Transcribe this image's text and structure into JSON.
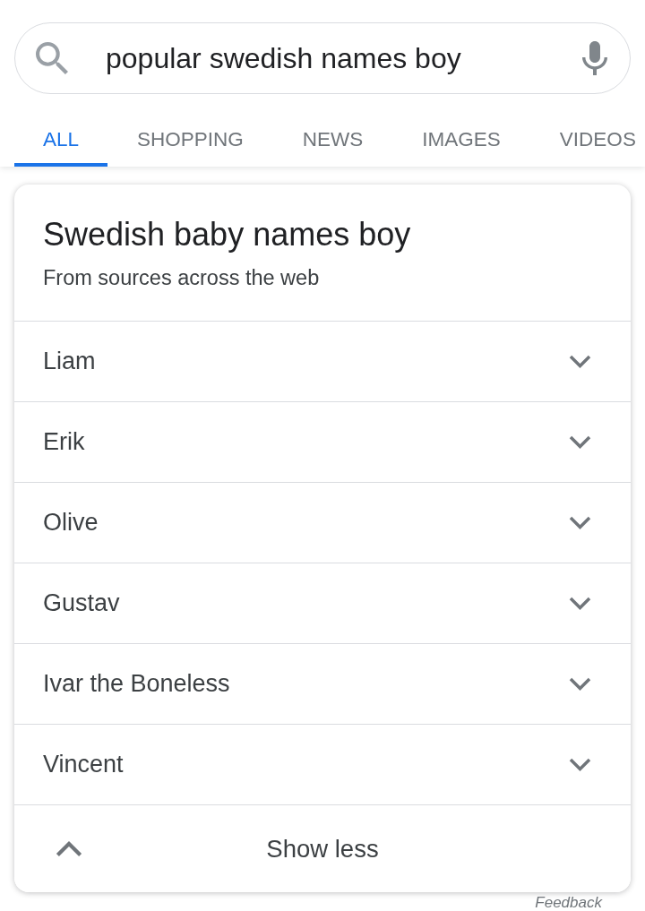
{
  "search": {
    "value": "popular swedish names boy"
  },
  "tabs": [
    {
      "label": "ALL",
      "selected": true
    },
    {
      "label": "SHOPPING",
      "selected": false
    },
    {
      "label": "NEWS",
      "selected": false
    },
    {
      "label": "IMAGES",
      "selected": false
    },
    {
      "label": "VIDEOS",
      "selected": false
    }
  ],
  "card": {
    "title": "Swedish baby names boy",
    "subtitle": "From sources across the web",
    "items": [
      {
        "name": "Liam",
        "expanded": false
      },
      {
        "name": "Erik",
        "expanded": false
      },
      {
        "name": "Olive",
        "expanded": false
      },
      {
        "name": "Gustav",
        "expanded": false
      },
      {
        "name": "Ivar the Boneless",
        "expanded": false
      },
      {
        "name": "Vincent",
        "expanded": false
      }
    ],
    "toggle": {
      "label": "Show less",
      "expanded": true
    }
  },
  "feedback": "Feedback"
}
